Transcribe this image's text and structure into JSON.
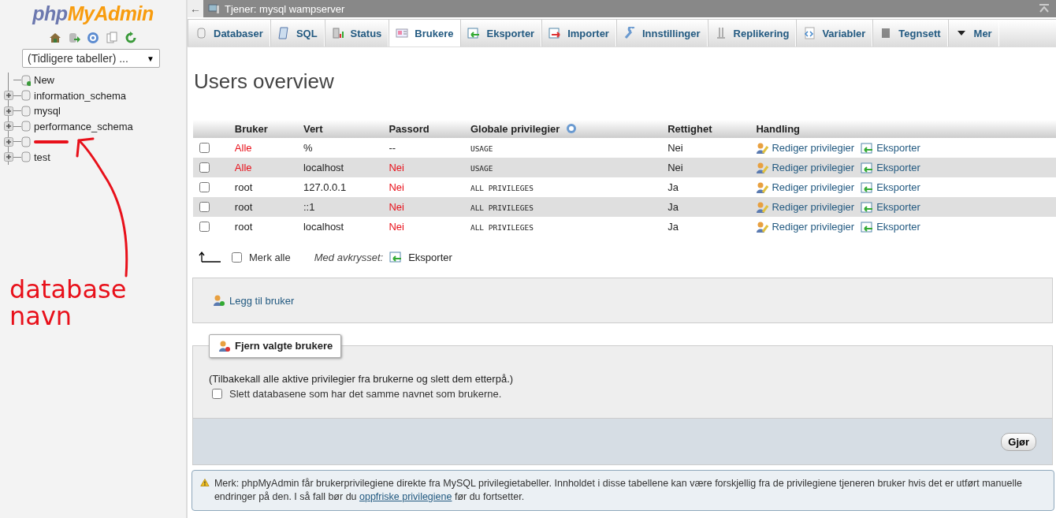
{
  "sidebar": {
    "logo": {
      "php": "php",
      "rest": "MyAdmin"
    },
    "recent_select": {
      "value": "(Tidligere tabeller) ...",
      "arrow": "▼"
    },
    "tree": [
      {
        "label": "New",
        "kind": "new",
        "redacted": false
      },
      {
        "label": "information_schema",
        "kind": "db",
        "redacted": false
      },
      {
        "label": "mysql",
        "kind": "db",
        "redacted": false
      },
      {
        "label": "performance_schema",
        "kind": "db",
        "redacted": false
      },
      {
        "kind": "db",
        "redacted": true
      },
      {
        "label": "test",
        "kind": "db",
        "redacted": false
      }
    ],
    "annotation": {
      "text": "database navn"
    }
  },
  "top_bar": {
    "back": "←",
    "title": "Tjener: mysql wampserver"
  },
  "tabs": [
    {
      "label": "Databaser",
      "selected": false
    },
    {
      "label": "SQL",
      "selected": false
    },
    {
      "label": "Status",
      "selected": false
    },
    {
      "label": "Brukere",
      "selected": true
    },
    {
      "label": "Eksporter",
      "selected": false
    },
    {
      "label": "Importer",
      "selected": false
    },
    {
      "label": "Innstillinger",
      "selected": false
    },
    {
      "label": "Replikering",
      "selected": false
    },
    {
      "label": "Variabler",
      "selected": false
    },
    {
      "label": "Tegnsett",
      "selected": false
    },
    {
      "label": "Mer",
      "selected": false
    }
  ],
  "heading": "Users overview",
  "table": {
    "columns": [
      "Bruker",
      "Vert",
      "Passord",
      "Globale privilegier",
      "Rettighet",
      "Handling"
    ],
    "rows": [
      {
        "checked": false,
        "user": "Alle",
        "any_user": true,
        "host": "%",
        "password": "--",
        "no_password": false,
        "privileges": "USAGE",
        "grant": "Nei",
        "edit": "Rediger privilegier",
        "export": "Eksporter"
      },
      {
        "checked": false,
        "user": "Alle",
        "any_user": true,
        "host": "localhost",
        "password": "Nei",
        "no_password": true,
        "privileges": "USAGE",
        "grant": "Nei",
        "edit": "Rediger privilegier",
        "export": "Eksporter"
      },
      {
        "checked": false,
        "user": "root",
        "any_user": false,
        "host": "127.0.0.1",
        "password": "Nei",
        "no_password": true,
        "privileges": "ALL PRIVILEGES",
        "grant": "Ja",
        "edit": "Rediger privilegier",
        "export": "Eksporter"
      },
      {
        "checked": false,
        "user": "root",
        "any_user": false,
        "host": "::1",
        "password": "Nei",
        "no_password": true,
        "privileges": "ALL PRIVILEGES",
        "grant": "Ja",
        "edit": "Rediger privilegier",
        "export": "Eksporter"
      },
      {
        "checked": false,
        "user": "root",
        "any_user": false,
        "host": "localhost",
        "password": "Nei",
        "no_password": true,
        "privileges": "ALL PRIVILEGES",
        "grant": "Ja",
        "edit": "Rediger privilegier",
        "export": "Eksporter"
      }
    ],
    "select_all": {
      "label": "Merk alle",
      "checked": false
    },
    "with_selected": "Med avkrysset:",
    "bulk_export": "Eksporter"
  },
  "add_user": "Legg til bruker",
  "remove": {
    "legend": "Fjern valgte brukere",
    "description": "(Tilbakekall alle aktive privilegier fra brukerne og slett dem etterpå.)",
    "drop_db": {
      "label": "Slett databasene som har det samme navnet som brukerne.",
      "checked": false
    },
    "go": "Gjør"
  },
  "notice": {
    "before": "Merk: phpMyAdmin får brukerprivilegiene direkte fra MySQL privilegietabeller. Innholdet i disse tabellene kan være forskjellig fra de privilegiene tjeneren bruker hvis det er utført manuelle endringer på den. I så fall bør du",
    "link": "oppfriske privilegiene",
    "after": "før du fortsetter."
  }
}
